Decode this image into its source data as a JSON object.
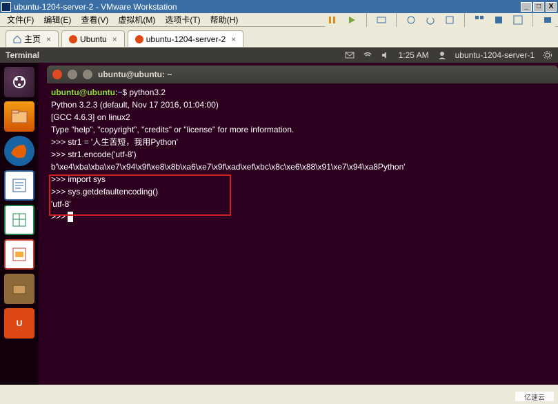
{
  "vmware": {
    "title": "ubuntu-1204-server-2 - VMware Workstation",
    "menus": [
      "文件(F)",
      "编辑(E)",
      "查看(V)",
      "虚拟机(M)",
      "选项卡(T)",
      "帮助(H)"
    ],
    "tabs": {
      "home": "主页",
      "ubuntu": "Ubuntu",
      "active": "ubuntu-1204-server-2"
    },
    "window_buttons": {
      "min": "_",
      "max": "□",
      "close": "X"
    }
  },
  "ubuntu_panel": {
    "app": "Terminal",
    "time": "1:25 AM",
    "user": "ubuntu-1204-server-1"
  },
  "terminal_window": {
    "title": "ubuntu@ubuntu: ~"
  },
  "terminal": {
    "prompt_user": "ubuntu@ubuntu",
    "prompt_sep": ":",
    "prompt_path": "~",
    "prompt_char": "$ ",
    "cmd1": "python3.2",
    "banner1": "Python 3.2.3 (default, Nov 17 2016, 01:04:00)",
    "banner2": "[GCC 4.6.3] on linux2",
    "banner3": "Type \"help\", \"copyright\", \"credits\" or \"license\" for more information.",
    "pyprompt": ">>> ",
    "stmt1": "str1 = '人生苦短，我用Python'",
    "stmt2": "str1.encode('utf-8')",
    "out2": "b'\\xe4\\xba\\xba\\xe7\\x94\\x9f\\xe8\\x8b\\xa6\\xe7\\x9f\\xad\\xef\\xbc\\x8c\\xe6\\x88\\x91\\xe7\\x94\\xa8Python'",
    "stmt3": "import sys",
    "stmt4": "sys.getdefaultencoding()",
    "out4": "'utf-8'"
  },
  "watermark": "亿速云"
}
